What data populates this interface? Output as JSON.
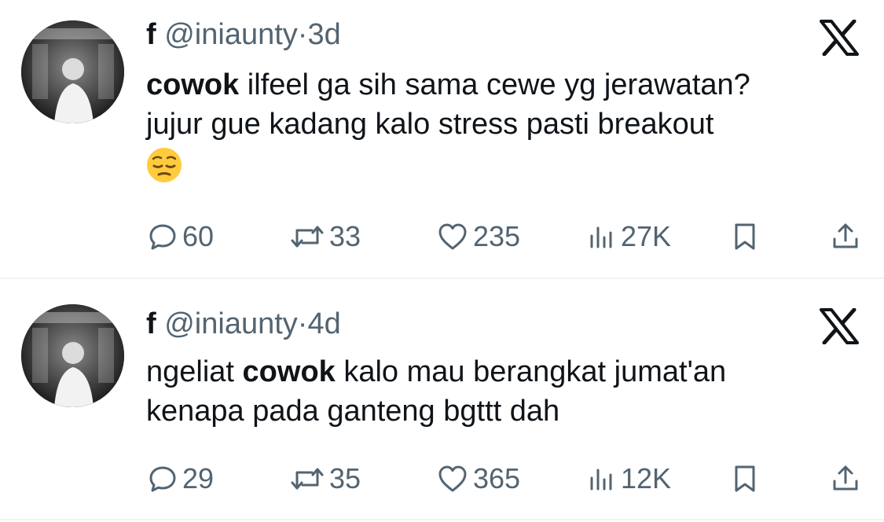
{
  "tweets": [
    {
      "display_name": "f",
      "handle": "@iniaunty",
      "separator": "·",
      "time": "3d",
      "body_lines": [
        {
          "bold": "cowok",
          "rest": " ilfeel ga sih sama cewe yg jerawatan?"
        },
        {
          "bold": "",
          "rest": "jujur gue kadang kalo stress pasti breakout"
        }
      ],
      "emoji": "pensive-face",
      "replies": "60",
      "reposts": "33",
      "likes": "235",
      "views": "27K"
    },
    {
      "display_name": "f",
      "handle": "@iniaunty",
      "separator": "·",
      "time": "4d",
      "body_lines": [
        {
          "pre": "ngeliat ",
          "bold": "cowok",
          "rest": " kalo mau berangkat jumat'an"
        },
        {
          "bold": "",
          "rest": "kenapa pada ganteng bgttt dah"
        }
      ],
      "replies": "29",
      "reposts": "35",
      "likes": "365",
      "views": "12K"
    }
  ],
  "colors": {
    "text": "#0f1419",
    "muted": "#536471",
    "divider": "#eff3f4"
  },
  "icons": [
    "reply-icon",
    "repost-icon",
    "like-icon",
    "views-icon",
    "bookmark-icon",
    "share-icon",
    "x-logo-icon"
  ]
}
